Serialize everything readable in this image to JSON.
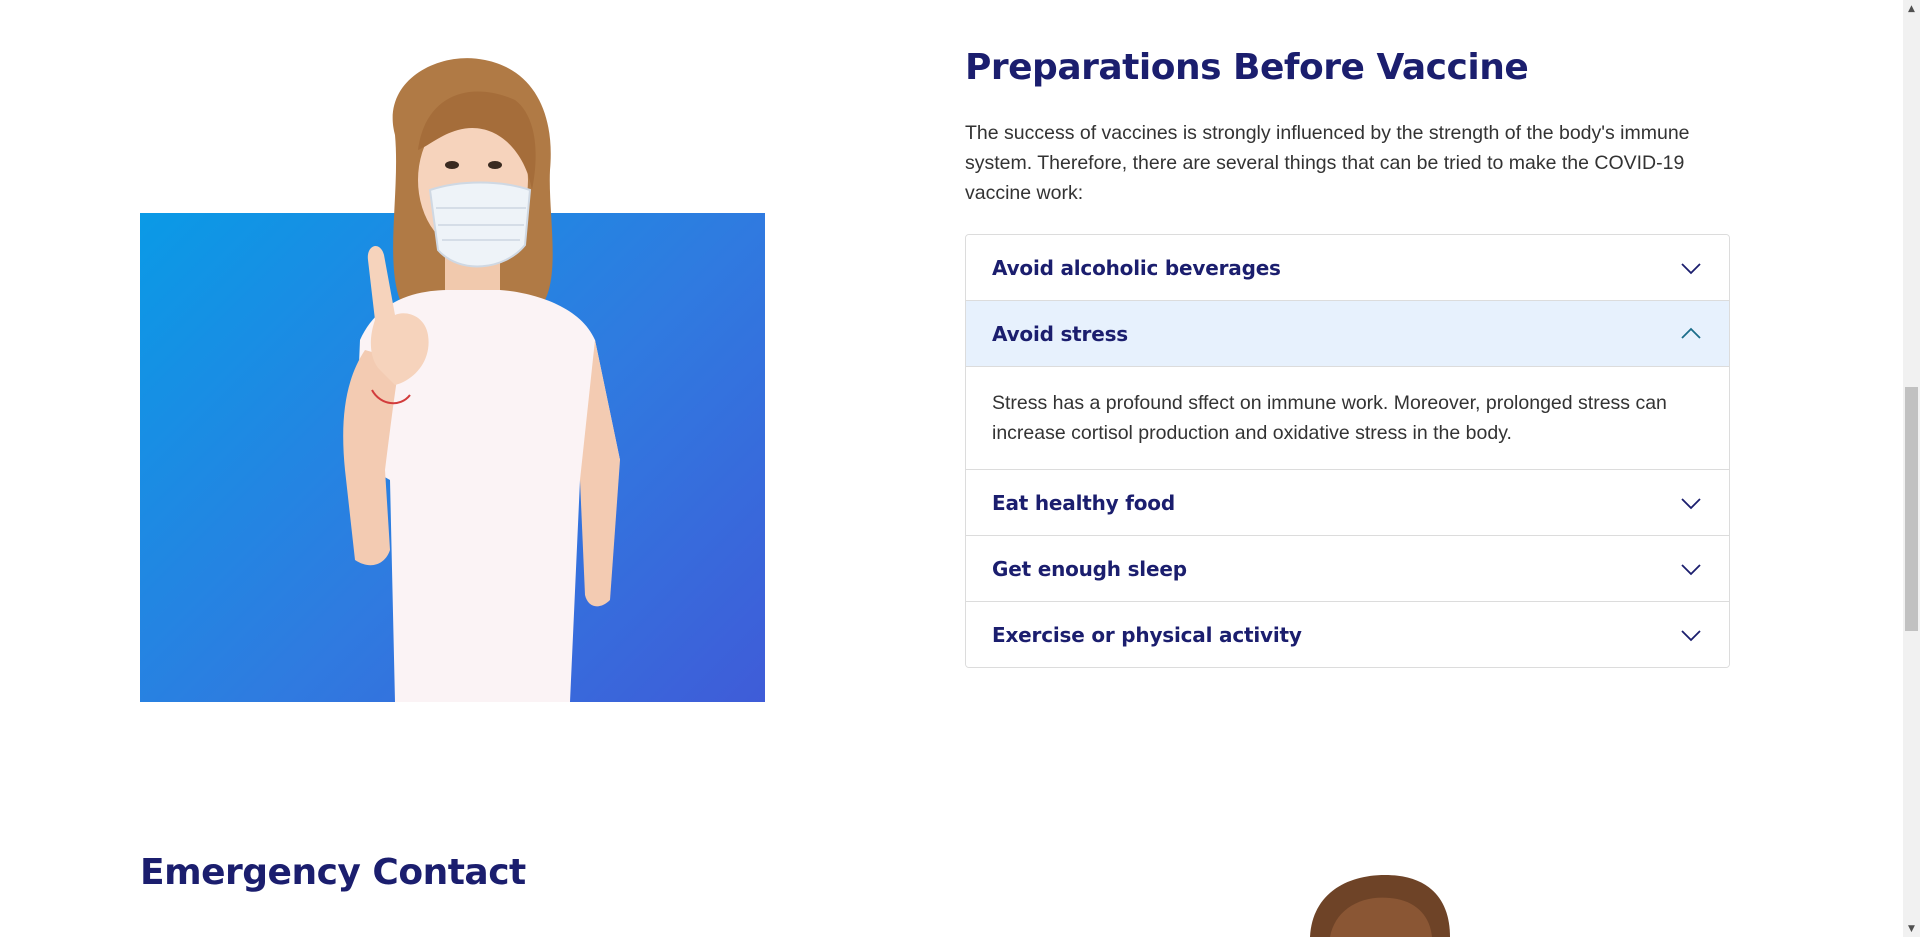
{
  "preparations": {
    "title": "Preparations Before Vaccine",
    "intro": "The success of vaccines is strongly influenced by the strength of the body's immune system. Therefore, there are several things that can be tried to make the COVID-19 vaccine work:",
    "accordion": [
      {
        "label": "Avoid alcoholic beverages",
        "expanded": false
      },
      {
        "label": "Avoid stress",
        "expanded": true,
        "body": "Stress has a profound sffect on immune work. Moreover, prolonged stress can increase cortisol production and oxidative stress in the body."
      },
      {
        "label": "Eat healthy food",
        "expanded": false
      },
      {
        "label": "Get enough sleep",
        "expanded": false
      },
      {
        "label": "Exercise or physical activity",
        "expanded": false
      }
    ]
  },
  "emergency": {
    "title": "Emergency Contact"
  },
  "colors": {
    "heading": "#1b1e6e",
    "accent_bg": "#e7f1fd",
    "image_blue": "#2f7be0",
    "chevron_open": "#1b6d8a"
  },
  "icons": {
    "collapsed": "chevron-down-icon",
    "expanded": "chevron-up-icon"
  }
}
